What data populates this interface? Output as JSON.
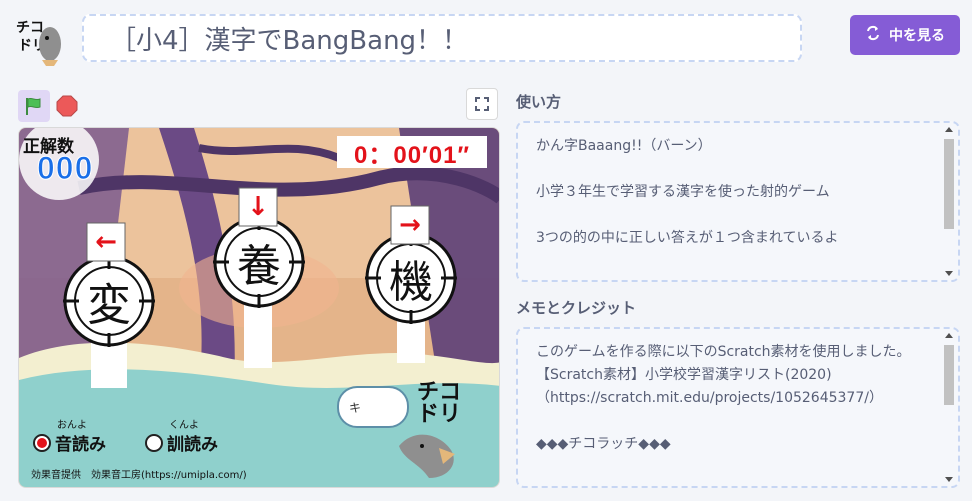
{
  "header": {
    "title": "［小4］漢字でBangBang！！",
    "see_inside_label": "中を見る",
    "avatar_text": "チコ\nドリ"
  },
  "stage": {
    "score_label": "正解数",
    "score_value": "000",
    "timer": "0：00′01″",
    "targets": [
      {
        "char": "変",
        "arrow": "←"
      },
      {
        "char": "養",
        "arrow": "↓"
      },
      {
        "char": "機",
        "arrow": "→"
      }
    ],
    "reading_options": [
      {
        "ruby": "おんよ",
        "label": "音読み",
        "selected": true
      },
      {
        "ruby": "くんよ",
        "label": "訓読み",
        "selected": false
      }
    ],
    "speech_text": "キ",
    "brand": "チコ\nドリ",
    "credit": "効果音提供　効果音工房(https://umipla.com/)"
  },
  "instructions": {
    "title": "使い方",
    "lines": [
      "かん字Baaang!!（バーン）",
      "",
      "小学３年生で学習する漢字を使った射的ゲーム",
      "",
      "3つの的の中に正しい答えが１つ含まれているよ"
    ]
  },
  "notes": {
    "title": "メモとクレジット",
    "lines": [
      "このゲームを作る際に以下のScratch素材を使用しました。",
      "【Scratch素材】小学校学習漢字リスト(2020)",
      "（https://scratch.mit.edu/projects/1052645377/）",
      "",
      "◆◆◆チコラッチ◆◆◆"
    ]
  },
  "colors": {
    "accent": "#855cd6",
    "flag": "#4cbf56",
    "stop": "#ec5959",
    "timer_red": "#e3121a",
    "score_blue": "#1a6fe8"
  }
}
